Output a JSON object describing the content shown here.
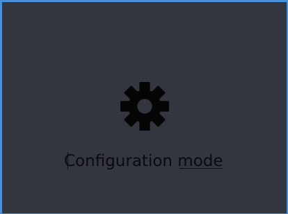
{
  "panel": {
    "background_color": "#33353f",
    "border_color": "#4a90d9",
    "icon": "gear-icon",
    "label": "Configuration mode"
  }
}
